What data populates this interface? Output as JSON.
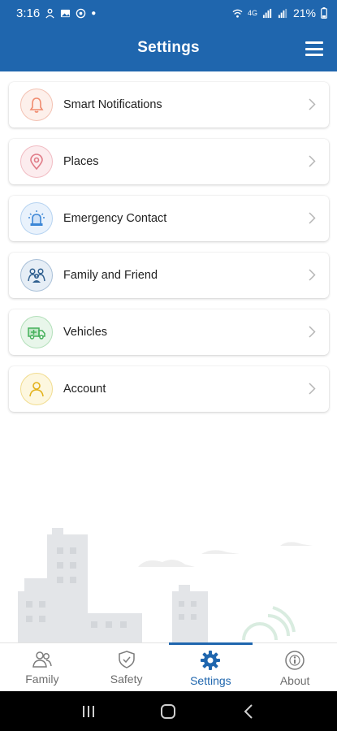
{
  "status_bar": {
    "time": "3:16",
    "battery": "21%",
    "network": "4G"
  },
  "app_bar": {
    "title": "Settings"
  },
  "settings": [
    {
      "label": "Smart Notifications",
      "icon": "bell-icon",
      "color": "#f08a6d",
      "bg": "#fdf0eb"
    },
    {
      "label": "Places",
      "icon": "map-pin-icon",
      "color": "#e07a86",
      "bg": "#fcecee"
    },
    {
      "label": "Emergency Contact",
      "icon": "siren-icon",
      "color": "#3b86d6",
      "bg": "#e9f2fc"
    },
    {
      "label": "Family and Friend",
      "icon": "family-icon",
      "color": "#2f5f8f",
      "bg": "#e6eef6"
    },
    {
      "label": "Vehicles",
      "icon": "truck-icon",
      "color": "#45b05a",
      "bg": "#e8f6ea"
    },
    {
      "label": "Account",
      "icon": "user-icon",
      "color": "#e3b21c",
      "bg": "#fdf7df"
    }
  ],
  "bottom_nav": [
    {
      "label": "Family",
      "icon": "people-icon",
      "active": false
    },
    {
      "label": "Safety",
      "icon": "shield-icon",
      "active": false
    },
    {
      "label": "Settings",
      "icon": "gear-icon",
      "active": true
    },
    {
      "label": "About",
      "icon": "info-icon",
      "active": false
    }
  ],
  "colors": {
    "primary": "#1f66ae",
    "inactive": "#6e6e6e"
  }
}
